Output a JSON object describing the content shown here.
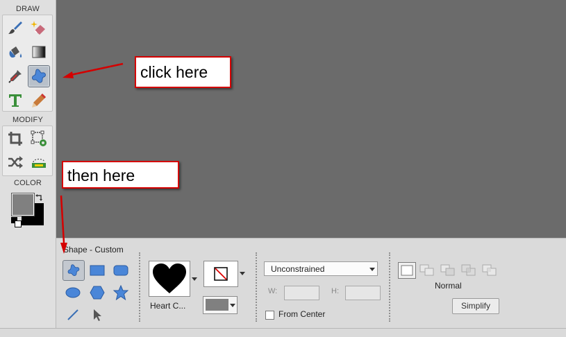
{
  "panel": {
    "draw_label": "DRAW",
    "modify_label": "MODIFY",
    "color_label": "COLOR"
  },
  "draw_tools": [
    {
      "icon": "brush-icon"
    },
    {
      "icon": "smart-eraser-icon"
    },
    {
      "icon": "paint-bucket-icon"
    },
    {
      "icon": "gradient-icon"
    },
    {
      "icon": "eyedropper-icon"
    },
    {
      "icon": "custom-shape-icon",
      "active": true
    },
    {
      "icon": "type-icon"
    },
    {
      "icon": "pencil-icon"
    }
  ],
  "modify_tools": [
    {
      "icon": "crop-icon"
    },
    {
      "icon": "recompose-icon"
    },
    {
      "icon": "move-icon"
    },
    {
      "icon": "straighten-icon"
    }
  ],
  "colors": {
    "foreground": "#808080",
    "background": "#000000",
    "accent": "#d40000"
  },
  "options": {
    "title": "Shape - Custom",
    "shape_label": "Heart C...",
    "constraint_value": "Unconstrained",
    "width_label": "W:",
    "height_label": "H:",
    "from_center_label": "From Center",
    "mode_label": "Normal",
    "simplify_label": "Simplify"
  },
  "callouts": {
    "first": "click here",
    "second": "then here"
  }
}
